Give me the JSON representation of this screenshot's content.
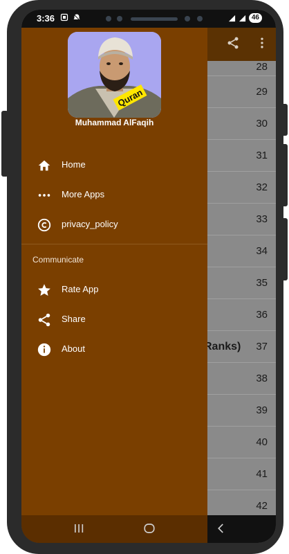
{
  "status_bar": {
    "time": "3:36",
    "battery": "46",
    "left_icons": [
      "screenshot-icon",
      "alarm-icon"
    ],
    "right_icons": [
      "signal-icon",
      "signal-icon"
    ]
  },
  "toolbar": {
    "icons": [
      "share-icon",
      "more-vert-icon"
    ]
  },
  "background_list": {
    "rows": [
      {
        "num": "28",
        "text": ""
      },
      {
        "num": "29",
        "text": ""
      },
      {
        "num": "30",
        "text": ""
      },
      {
        "num": "31",
        "text": ""
      },
      {
        "num": "32",
        "text": ""
      },
      {
        "num": "33",
        "text": ""
      },
      {
        "num": "34",
        "text": ""
      },
      {
        "num": "35",
        "text": ""
      },
      {
        "num": "36",
        "text": ""
      },
      {
        "num": "37",
        "text": "Ranks)"
      },
      {
        "num": "38",
        "text": ""
      },
      {
        "num": "39",
        "text": ""
      },
      {
        "num": "40",
        "text": ""
      },
      {
        "num": "41",
        "text": ""
      },
      {
        "num": "42",
        "text": ""
      }
    ]
  },
  "drawer": {
    "header": {
      "caption": "Muhammad AlFaqih",
      "badge": "Quran"
    },
    "items": [
      {
        "label": "Home",
        "icon": "home-icon"
      },
      {
        "label": "More Apps",
        "icon": "more-horiz-icon"
      },
      {
        "label": "privacy_policy",
        "icon": "copyright-icon"
      }
    ],
    "section_title": "Communicate",
    "section_items": [
      {
        "label": "Rate App",
        "icon": "star-icon"
      },
      {
        "label": "Share",
        "icon": "share-icon"
      },
      {
        "label": "About",
        "icon": "info-icon"
      }
    ]
  },
  "nav_bar": {
    "buttons": [
      "recents-button",
      "home-button",
      "back-button"
    ]
  },
  "colors": {
    "drawer_bg": "#7a3f00",
    "toolbar_bg": "#5b3203",
    "badge_bg": "#ffe600"
  }
}
